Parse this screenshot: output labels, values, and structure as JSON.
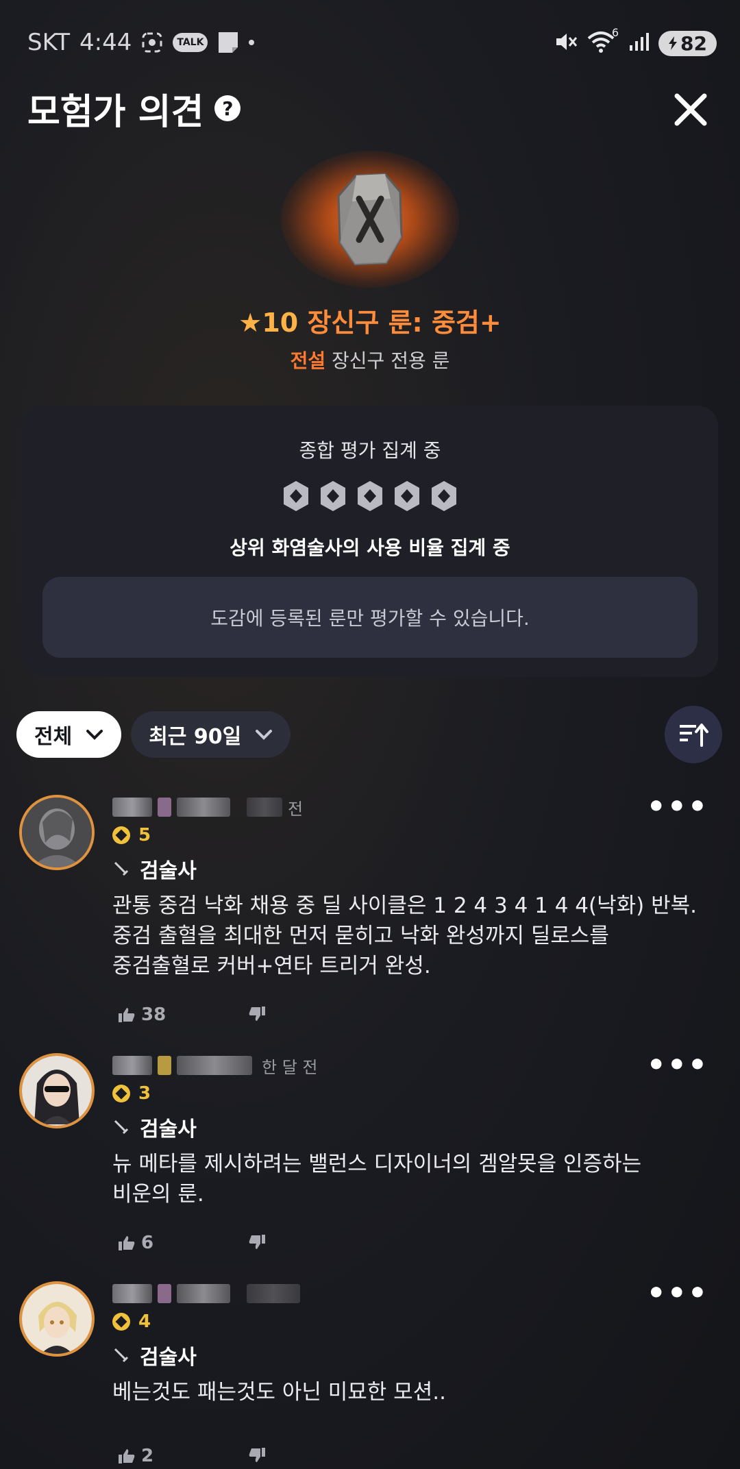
{
  "status": {
    "carrier": "SKT",
    "time": "4:44",
    "talk_label": "TALK",
    "battery": "82",
    "net_badge": "6"
  },
  "header": {
    "title": "모험가 의견",
    "help_glyph": "?"
  },
  "item": {
    "star": "★",
    "grade": "10",
    "name": "장신구 룬: 중검+",
    "rarity": "전설",
    "desc": "장신구 전용 룬"
  },
  "evaluation": {
    "title": "종합 평가 집계 중",
    "subtitle": "상위 화염술사의 사용 비율 집계 중",
    "notice": "도감에 등록된 룬만 평가할 수 있습니다."
  },
  "filters": {
    "all_label": "전체",
    "period_label": "최근 90일"
  },
  "comments": [
    {
      "time": "전",
      "level": "5",
      "class": "검술사",
      "text": "관통 중검 낙화 채용 중  딜 사이클은 1 2 4 3 4 1 4 4(낙화) 반복.\n중검 출혈을 최대한 먼저 묻히고 낙화 완성까지 딜로스를\n중검출혈로 커버+연타 트리거 완성.",
      "likes": "38"
    },
    {
      "time": "한 달 전",
      "level": "3",
      "class": "검술사",
      "text": "뉴 메타를 제시하려는 밸런스 디자이너의 겜알못을 인증하는\n비운의 룬.",
      "likes": "6"
    },
    {
      "time": "",
      "level": "4",
      "class": "검술사",
      "text": "베는것도 패는것도 아닌 미묘한 모션..",
      "likes": "2"
    }
  ],
  "colors": {
    "accent_orange": "#ff8c3a",
    "gold": "#f0c23c",
    "card_bg": "#1f2027"
  }
}
